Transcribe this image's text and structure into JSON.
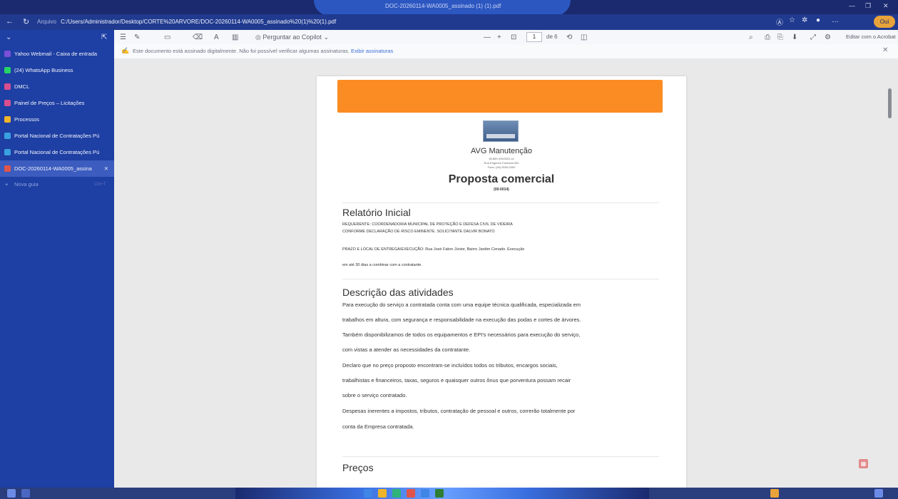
{
  "window": {
    "title": "DOC-20260114-WA0005_assinado (1) (1).pdf",
    "controls": [
      "—",
      "❐",
      "✕"
    ]
  },
  "browser": {
    "url_label": "Arquivo",
    "url": "C:/Users/Administrador/Desktop/CORTE%20ARVORE/DOC-20260114-WA0005_assinado%20(1)%20(1).pdf",
    "profile_label": "Oui"
  },
  "sidebar": {
    "items": [
      {
        "label": "Yahoo Webmail - Caixa de entrada",
        "color": "#7b4fd8"
      },
      {
        "label": "(24) WhatsApp Business",
        "color": "#25d366"
      },
      {
        "label": "DMCL",
        "color": "#d94e8f"
      },
      {
        "label": "Painel de Preços – Licitações",
        "color": "#d94e8f"
      },
      {
        "label": "Processos",
        "color": "#f0b429"
      },
      {
        "label": "Portal Nacional de Contratações Pú",
        "color": "#3aa0e0"
      },
      {
        "label": "Portal Nacional de Contratações Pú",
        "color": "#3aa0e0"
      },
      {
        "label": "DOC-20260114-WA0005_assina",
        "color": "#e0544a",
        "active": true
      }
    ],
    "new_tab_label": "Nova guia",
    "new_tab_shortcut": "Ctrl+T"
  },
  "toolbar": {
    "ask_copilot": "Perguntar ao Copilot",
    "zoom_out": "—",
    "zoom_in": "+",
    "page_current": "1",
    "page_total": "de 6",
    "edit_acrobat": "Editar com o Acrobat",
    "signature_notice": "Este documento está assinado digitalmente. Não foi possível verificar algumas assinaturas.",
    "signature_link": "Exibir assinaturas"
  },
  "document": {
    "company": "AVG Manutenção",
    "info_lines": [
      "46.869.410/0001-xx",
      "Rua Engenho Fazenda 000",
      "Fone: (49) 0000-0000"
    ],
    "title": "Proposta comercial",
    "number": "(00-0014)",
    "section1_title": "Relatório Inicial",
    "section1_line1": "REQUERENTE: COORDENADORIA MUNICIPAL DE PROTEÇÃO E DEFESA CIVIL DE VIDEIRA",
    "section1_line2": "CONFORME DECLARAÇÃO DE RISCO EMINENTE. SOLICITANTE DALVIR BONATO",
    "section1_line3": "PRAZO E LOCAL DE ENTREGA/EXECUÇÃO: Rua José Fabro Júnior, Bairro Jardim Cenado. Execução",
    "section1_line4": "em até 30 dias a combinar com a contratante.",
    "section2_title": "Descrição das atividades",
    "section2_lines": [
      "Para execução do serviço a contratada conta com uma equipe técnica qualificada, especializada em",
      "trabalhos em altura, com segurança e responsabilidade na execução das podas e cortes de árvores.",
      "Também disponibilizamos de todos os equipamentos e EPI's necessários para execução do serviço,",
      "com vistas a atender as necessidades da contratante.",
      "Declaro que no preço proposto encontram-se incluídos todos os tributos, encargos sociais,",
      "trabalhistas e financeiros, taxas, seguros e quaisquer outros ônus que porventura possam recair",
      "sobre o serviço contratado.",
      "Despesas inerentes a impostos, tributos, contratação de pessoal e outros, correrão totalmente por",
      "conta da Empresa contratada."
    ],
    "section3_title": "Preços"
  },
  "colors": {
    "banner": "#fb8c23",
    "sidebar": "#1e3fa3",
    "titlebar": "#1b2a6e"
  }
}
